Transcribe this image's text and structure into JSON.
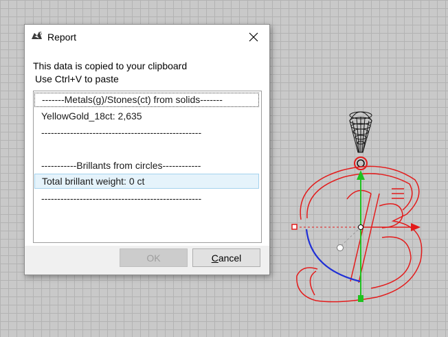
{
  "dialog": {
    "title": "Report",
    "message_line1": "This data is copied to your clipboard",
    "message_line2": "Use Ctrl+V to paste",
    "list_items": [
      "-------Metals(g)/Stones(ct) from solids-------",
      "YellowGold_18ct: 2,635",
      "--------------------------------------------------",
      "",
      "-----------Brillants from circles------------",
      "Total brillant weight: 0 ct",
      "--------------------------------------------------"
    ],
    "selected_index": 5,
    "focused_index": 0,
    "ok_label": "OK",
    "ok_enabled": false,
    "cancel_label_underlined": "C",
    "cancel_label_rest": "ancel"
  },
  "colors": {
    "viewport_background": "#c9c9c9",
    "grid_line": "#b3b3b3",
    "curve_red": "#e31b1b",
    "axis_green": "#1fc21f",
    "arc_blue": "#1f2fd6",
    "selection_bg": "#e5f3fb"
  },
  "icons": {
    "app": "rhino-icon",
    "close": "close-icon"
  }
}
